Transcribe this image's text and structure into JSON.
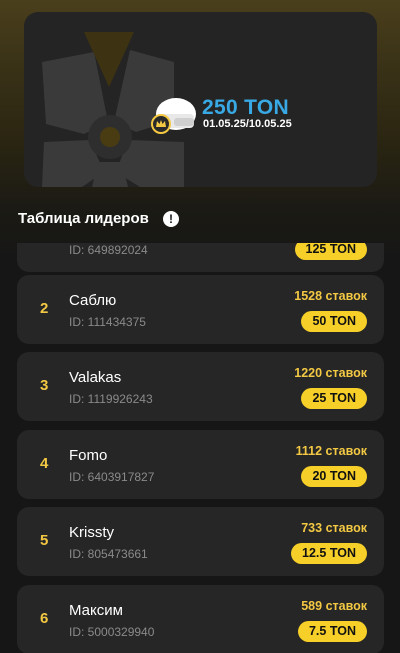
{
  "banner": {
    "prize_amount": "250 TON",
    "dates": "01.05.25/10.05.25"
  },
  "leaderboard": {
    "title": "Таблица лидеров",
    "info_symbol": "!",
    "rows": [
      {
        "rank": "",
        "name": "",
        "id": "ID: 649892024",
        "bets": "",
        "prize": "125 TON"
      },
      {
        "rank": "2",
        "name": "Саблю",
        "id": "ID: 111434375",
        "bets": "1528 ставок",
        "prize": "50 TON"
      },
      {
        "rank": "3",
        "name": "Valakas",
        "id": "ID: 1119926243",
        "bets": "1220 ставок",
        "prize": "25 TON"
      },
      {
        "rank": "4",
        "name": "Fomo",
        "id": "ID: 6403917827",
        "bets": "1112 ставок",
        "prize": "20 TON"
      },
      {
        "rank": "5",
        "name": "Krissty",
        "id": "ID: 805473661",
        "bets": "733 ставок",
        "prize": "12.5 TON"
      },
      {
        "rank": "6",
        "name": "Максим",
        "id": "ID: 5000329940",
        "bets": "589 ставок",
        "prize": "7.5 TON"
      }
    ]
  },
  "colors": {
    "accent_gold": "#f3c843",
    "prize_badge": "#f6cf28",
    "prize_blue": "#38a9e4",
    "card": "#262626",
    "background": "#161616"
  },
  "icons": {
    "banner_logo": "wheel-logo-icon",
    "prize": "crown-helmet-icon",
    "info": "info-icon"
  }
}
